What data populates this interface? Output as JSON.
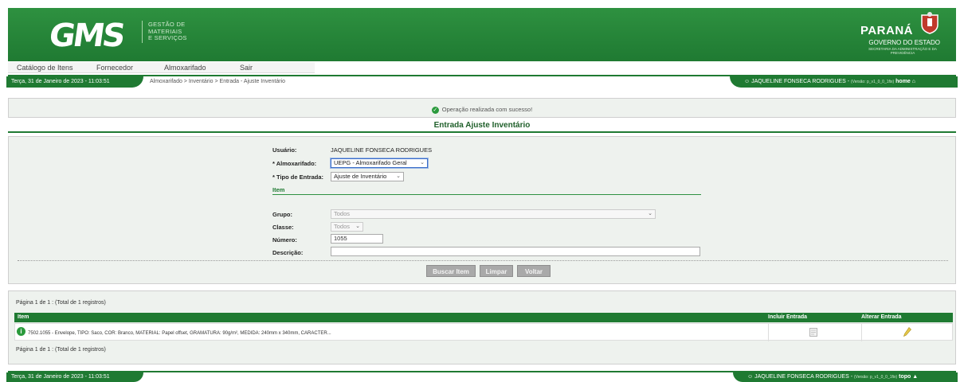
{
  "header": {
    "logo_text": "GMS",
    "logo_sub": [
      "GESTÃO DE",
      "MATERIAIS",
      "E SERVIÇOS"
    ],
    "state_name": "PARANÁ",
    "state_gov": "GOVERNO DO ESTADO",
    "state_secretaria": "SECRETARIA DA ADMINISTRAÇÃO E DA PREVIDÊNCIA"
  },
  "menu": {
    "items": [
      {
        "label": "Catálogo de Itens"
      },
      {
        "label": "Fornecedor"
      },
      {
        "label": "Almoxarifado"
      },
      {
        "label": "Sair"
      }
    ]
  },
  "navbar": {
    "date": "Terça, 31 de Janeiro de 2023 - 11:03:51",
    "breadcrumb": "Almoxarifado > Inventário > Entrada - Ajuste Inventário",
    "user": "JAQUELINE FONSECA RODRIGUES",
    "version": "(Versão: p_v1_0_0_1fix)",
    "home": "home"
  },
  "message": "Operação realizada com sucesso!",
  "page_title": "Entrada Ajuste Inventário",
  "form": {
    "usuario_label": "Usuário:",
    "usuario_value": "JAQUELINE FONSECA RODRIGUES",
    "almox_label": "* Almoxarifado:",
    "almox_value": "UEPG - Almoxarifado Geral",
    "tipo_label": "* Tipo de Entrada:",
    "tipo_value": "Ajuste de Inventário",
    "item_section": "Item",
    "grupo_label": "Grupo:",
    "grupo_value": "Todos",
    "classe_label": "Classe:",
    "classe_value": "Todos",
    "numero_label": "Número:",
    "numero_value": "1055",
    "descricao_label": "Descrição:",
    "descricao_value": ""
  },
  "buttons": {
    "buscar": "Buscar Item",
    "limpar": "Limpar",
    "voltar": "Voltar"
  },
  "results": {
    "pagination_top": "Página 1 de 1 : (Total de 1 registros)",
    "pagination_bottom": "Página 1 de 1 : (Total de 1 registros)",
    "columns": [
      "Item",
      "Incluir Entrada",
      "Alterar Entrada"
    ],
    "rows": [
      {
        "item": "7502.1055 - Envelope, TIPO: Saco, COR: Branco, MATERIAL: Papel offset, GRAMATURA: 90g/m², MEDIDA: 240mm x 340mm, CARACTER..."
      }
    ]
  },
  "footer": {
    "date": "Terça, 31 de Janeiro de 2023 - 11:03:51",
    "user": "JAQUELINE FONSECA RODRIGUES",
    "version": "(Versão: p_v1_0_0_1fix)",
    "topo": "topo"
  },
  "colors": {
    "brand_green": "#1f7a32",
    "button_gray": "#a9a9a9"
  }
}
